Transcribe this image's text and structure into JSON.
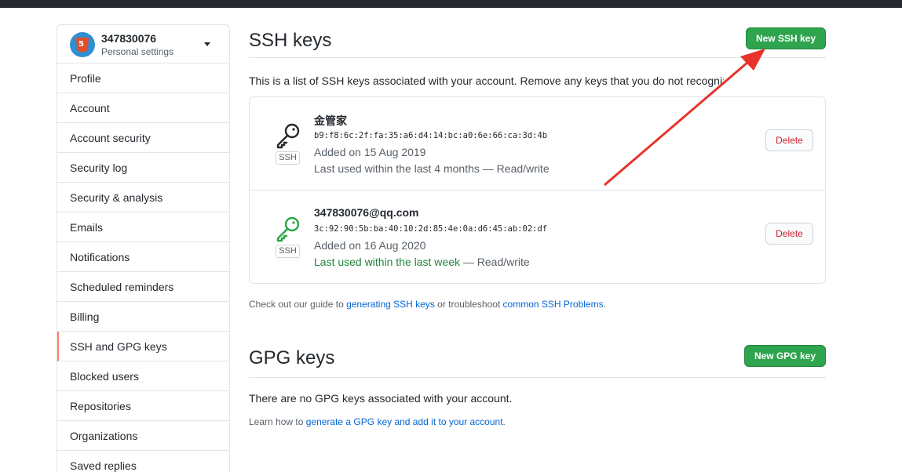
{
  "user": {
    "name": "347830076",
    "subtitle": "Personal settings"
  },
  "sidebar": {
    "items": [
      {
        "label": "Profile"
      },
      {
        "label": "Account"
      },
      {
        "label": "Account security"
      },
      {
        "label": "Security log"
      },
      {
        "label": "Security & analysis"
      },
      {
        "label": "Emails"
      },
      {
        "label": "Notifications"
      },
      {
        "label": "Scheduled reminders"
      },
      {
        "label": "Billing"
      },
      {
        "label": "SSH and GPG keys",
        "active": true
      },
      {
        "label": "Blocked users"
      },
      {
        "label": "Repositories"
      },
      {
        "label": "Organizations"
      },
      {
        "label": "Saved replies"
      }
    ]
  },
  "ssh": {
    "title": "SSH keys",
    "new_button": "New SSH key",
    "description": "This is a list of SSH keys associated with your account. Remove any keys that you do not recognize.",
    "keys": [
      {
        "title": "金管家",
        "fingerprint": "b9:f8:6c:2f:fa:35:a6:d4:14:bc:a0:6e:66:ca:3d:4b",
        "added": "Added on 15 Aug 2019",
        "last_used": "Last used within the last 4 months",
        "access": " — Read/write",
        "badge": "SSH",
        "delete": "Delete",
        "icon_color": "#24292e"
      },
      {
        "title": "347830076@qq.com",
        "fingerprint": "3c:92:90:5b:ba:40:10:2d:85:4e:0a:d6:45:ab:02:df",
        "added": "Added on 16 Aug 2020",
        "last_used": "Last used within the last week",
        "access": " — Read/write",
        "badge": "SSH",
        "delete": "Delete",
        "icon_color": "#28a745"
      }
    ],
    "guide_prefix": "Check out our guide to ",
    "guide_link1": "generating SSH keys",
    "guide_mid": " or troubleshoot ",
    "guide_link2": "common SSH Problems",
    "guide_suffix": "."
  },
  "gpg": {
    "title": "GPG keys",
    "new_button": "New GPG key",
    "empty": "There are no GPG keys associated with your account.",
    "learn_prefix": "Learn how to ",
    "learn_link": "generate a GPG key and add it to your account",
    "learn_suffix": "."
  },
  "colors": {
    "accent_green": "#2ea44f",
    "link": "#0366d6",
    "danger": "#cb2431",
    "active_marker": "#f9826c",
    "annotation_arrow": "#e8322b"
  }
}
